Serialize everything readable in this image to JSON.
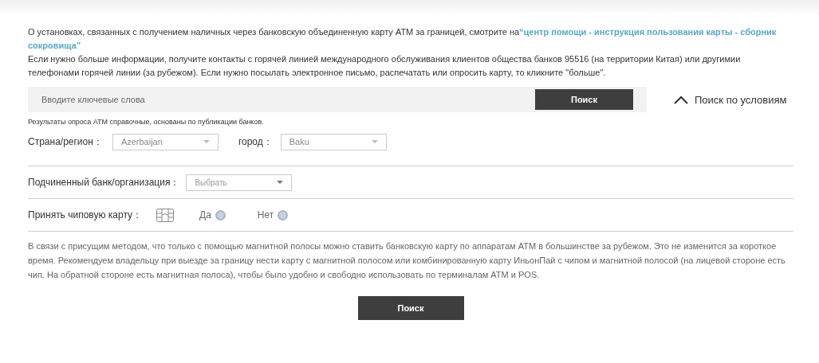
{
  "intro": {
    "text": "О установках, связанных с получением наличных через банковскую объединенную карту АТМ за границей, смотрите на",
    "link_lines": [
      "“центр помощи - инструкция пользования карты - сборник",
      "сокровища”"
    ]
  },
  "contact_text": "Если нужно больше информации, получите контакты с горячей линией международного обслуживания клиентов общества банков 95516 (на территории Китая) или другимии телефонами горячей линии (за рубежом). Если нужно посылать электронное письмо, распечатать или опросить карту, то кликните \"больше\".",
  "search": {
    "placeholder": "Вводите ключевые слова",
    "button": "Поиск",
    "toggle": "Поиск по условиям",
    "expanded": true
  },
  "note": "Результаты опроса АТМ справочные, основаны по публикации банков.",
  "country": {
    "label": "Страна/регион：",
    "value": "Azerbaijan"
  },
  "city": {
    "label": "город：",
    "value": "Baku"
  },
  "bank": {
    "label": "Подчиненный банк/организация：",
    "placeholder": "Выбрать"
  },
  "chip": {
    "label": "Принять чиповую карту：",
    "options": [
      {
        "label": "Да",
        "selected": false
      },
      {
        "label": "Нет",
        "selected": false
      }
    ]
  },
  "notice": "В связи с присущим методом, что только с помощью магнитной полосы можно ставить банковскую карту по аппаратам АТМ в большинстве за рубежом. Это не изменится за короткое время. Рекомендуем владельцу при выезде за границу нести карту с магнитной полосом или комбинированную карту ИньонПай с чипом и магнитной полосой (на лицевой стороне есть чип. На обратной стороне есть магнитная полоса), чтобы было удобно и свободно использовать по терминалам АТМ и POS.",
  "submit": "Поиск"
}
